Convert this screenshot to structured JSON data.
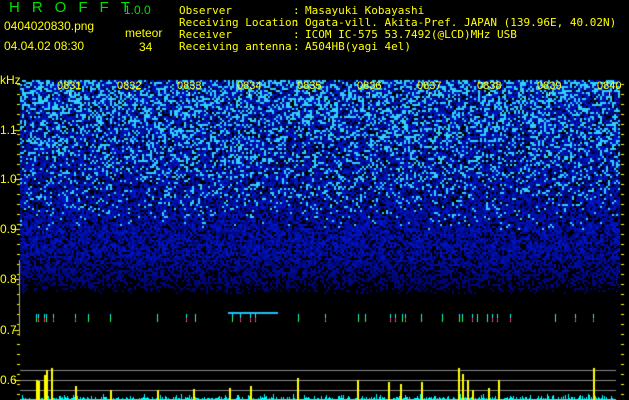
{
  "header": {
    "app_name": "HROFFT",
    "version": "1.0.0",
    "filename": "0404020830.png",
    "datetime": "04.04.02 08:30",
    "meteor_label": "meteor",
    "meteor_count": "34"
  },
  "info": {
    "rows": [
      {
        "label": "Observer",
        "value": "Masayuki Kobayashi"
      },
      {
        "label": "Receiving Location",
        "value": "Ogata-vill. Akita-Pref. JAPAN (139.96E, 40.02N)"
      },
      {
        "label": "Receiver",
        "value": "ICOM IC-575 53.7492(@LCD)MHz USB"
      },
      {
        "label": "Receiving antenna",
        "value": "A504HB(yagi 4el)"
      }
    ],
    "separator": ":"
  },
  "spectrogram": {
    "unit": "kHz",
    "freq_labels": [
      "1.1",
      "1.0",
      "0.9",
      "0.8",
      "0.7",
      "0.6"
    ],
    "time_labels": [
      "0831",
      "0832",
      "0833",
      "0834",
      "0835",
      "0836",
      "0837",
      "0838",
      "0839",
      "0840"
    ]
  },
  "colors": {
    "text": "#ffff00",
    "title": "#00e000",
    "noise": "#0010c0",
    "count": "#00ffff"
  }
}
